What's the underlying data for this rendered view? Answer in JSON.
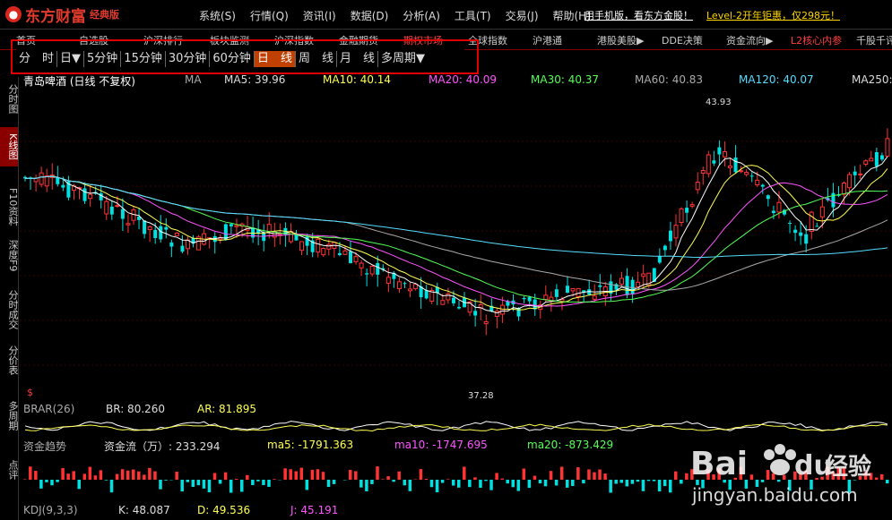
{
  "app": {
    "logo_text": "东方财富",
    "edition": "经典版",
    "brand_color": "#e23b2e"
  },
  "menu": [
    "系统(S)",
    "行情(Q)",
    "资讯(I)",
    "数据(D)",
    "分析(A)",
    "工具(T)",
    "交易(J)",
    "帮助(H)"
  ],
  "promos": {
    "mobile": "用手机版，看东方金股！",
    "level2": "Level-2开年钜惠，仅298元！"
  },
  "nav_tabs": [
    "首页",
    "自选股",
    "沪深排行",
    "板块监测",
    "沪深指数",
    "金融期货",
    "期权市场",
    "全球指数",
    "沪港通",
    "港股美股▶",
    "DDE决策",
    "资金流向▶",
    "L2核心内参",
    "千股千评"
  ],
  "period_buttons": {
    "items": [
      "分　时",
      "日▼",
      "5分钟",
      "15分钟",
      "30分钟",
      "60分钟",
      "日　线",
      "周　线",
      "月　线",
      "多周期▼"
    ],
    "active": "日　线"
  },
  "left_tabs": [
    "分时图",
    "K线图",
    "F10资料",
    "深度F9",
    "分时成交",
    "分价表",
    "多周期",
    "点评"
  ],
  "main_indicator": {
    "stock": "青岛啤酒 (日线 不复权)",
    "ma_label": "MA",
    "ma5": "MA5: 39.96",
    "ma10": "MA10: 40.14",
    "ma20": "MA20: 40.09",
    "ma30": "MA30: 40.37",
    "ma60": "MA60: 40.83",
    "ma120": "MA120: 40.07",
    "ma250": "MA250:",
    "high_label": "43.93",
    "low_label": "37.28",
    "colors": {
      "ma5": "#ffffff",
      "ma10": "#ffff55",
      "ma20": "#ff55ff",
      "ma30": "#55ff55",
      "ma60": "#aaaaaa",
      "ma120": "#55ddff",
      "up": "#ff3333",
      "down": "#00e0e0"
    }
  },
  "brar": {
    "title": "BRAR(26)",
    "br": "BR: 80.260",
    "ar": "AR: 81.895"
  },
  "money_flow": {
    "title": "资金趋势",
    "flow": "资金流（万）: 233.294",
    "ma5": "ma5: -1791.363",
    "ma10": "ma10: -1747.695",
    "ma20": "ma20: -873.429"
  },
  "kdj": {
    "title": "KDJ(9,3,3)",
    "k": "K: 48.087",
    "d": "D: 49.536",
    "j": "J: 45.191"
  },
  "watermark": {
    "brand": "Bai",
    "brand2": "du",
    "cn": "经验",
    "url": "jingyan.baidu.com"
  }
}
